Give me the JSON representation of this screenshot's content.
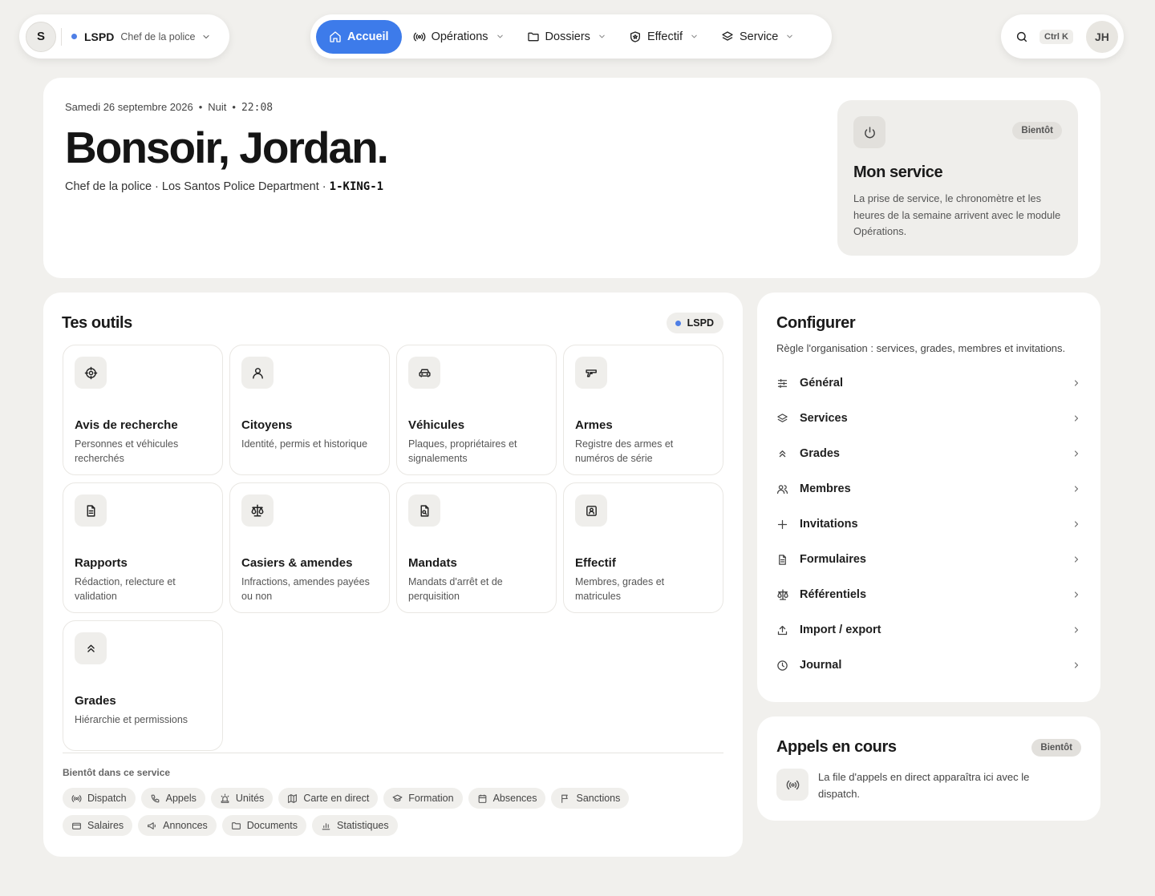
{
  "org": {
    "avatar": "S",
    "name": "LSPD",
    "role": "Chef de la police",
    "accent": "#4f7fe6"
  },
  "nav": {
    "items": [
      {
        "label": "Accueil",
        "icon": "home-icon",
        "active": true
      },
      {
        "label": "Opérations",
        "icon": "broadcast-icon"
      },
      {
        "label": "Dossiers",
        "icon": "folder-icon"
      },
      {
        "label": "Effectif",
        "icon": "shield-badge-icon"
      },
      {
        "label": "Service",
        "icon": "layers-icon"
      }
    ],
    "active_color": "#3d7bea"
  },
  "toolbar": {
    "shortcut": "Ctrl K",
    "user_initials": "JH"
  },
  "hero": {
    "date": "Samedi 26 septembre 2026",
    "period": "Nuit",
    "time": "22:08",
    "greeting": "Bonsoir, Jordan.",
    "subtitle": "Chef de la police · Los Santos Police Department · ",
    "callsign": "1-KING-1"
  },
  "service": {
    "badge": "Bientôt",
    "title": "Mon service",
    "text": "La prise de service, le chronomètre et les heures de la semaine arrivent avec le module Opérations."
  },
  "outils": {
    "title": "Tes outils",
    "badge": "LSPD",
    "tiles": [
      {
        "title": "Avis de recherche",
        "desc": "Personnes et véhicules recherchés",
        "icon": "target-icon"
      },
      {
        "title": "Citoyens",
        "desc": "Identité, permis et historique",
        "icon": "person-icon"
      },
      {
        "title": "Véhicules",
        "desc": "Plaques, propriétaires et signalements",
        "icon": "car-icon"
      },
      {
        "title": "Armes",
        "desc": "Registre des armes et numéros de série",
        "icon": "gun-icon"
      },
      {
        "title": "Rapports",
        "desc": "Rédaction, relecture et validation",
        "icon": "document-icon"
      },
      {
        "title": "Casiers & amendes",
        "desc": "Infractions, amendes payées ou non",
        "icon": "scale-icon"
      },
      {
        "title": "Mandats",
        "desc": "Mandats d'arrêt et de perquisition",
        "icon": "warrant-icon"
      },
      {
        "title": "Effectif",
        "desc": "Membres, grades et matricules",
        "icon": "id-card-icon"
      },
      {
        "title": "Grades",
        "desc": "Hiérarchie et permissions",
        "icon": "chevrons-up-icon"
      }
    ],
    "soon_label": "Bientôt dans ce service",
    "soon": [
      {
        "label": "Dispatch",
        "icon": "broadcast-icon"
      },
      {
        "label": "Appels",
        "icon": "phone-icon"
      },
      {
        "label": "Unités",
        "icon": "siren-icon"
      },
      {
        "label": "Carte en direct",
        "icon": "map-icon"
      },
      {
        "label": "Formation",
        "icon": "graduation-icon"
      },
      {
        "label": "Absences",
        "icon": "calendar-icon"
      },
      {
        "label": "Sanctions",
        "icon": "flag-icon"
      },
      {
        "label": "Salaires",
        "icon": "wallet-icon"
      },
      {
        "label": "Annonces",
        "icon": "megaphone-icon"
      },
      {
        "label": "Documents",
        "icon": "folder-icon"
      },
      {
        "label": "Statistiques",
        "icon": "bar-chart-icon"
      }
    ]
  },
  "config": {
    "title": "Configurer",
    "subtitle": "Règle l'organisation : services, grades, membres et invitations.",
    "items": [
      {
        "label": "Général",
        "icon": "sliders-icon"
      },
      {
        "label": "Services",
        "icon": "layers-icon"
      },
      {
        "label": "Grades",
        "icon": "chevrons-up-icon"
      },
      {
        "label": "Membres",
        "icon": "users-icon"
      },
      {
        "label": "Invitations",
        "icon": "plus-icon"
      },
      {
        "label": "Formulaires",
        "icon": "document-icon"
      },
      {
        "label": "Référentiels",
        "icon": "scale-icon"
      },
      {
        "label": "Import / export",
        "icon": "upload-icon"
      },
      {
        "label": "Journal",
        "icon": "clock-icon"
      }
    ]
  },
  "appels": {
    "title": "Appels en cours",
    "badge": "Bientôt",
    "text": "La file d'appels en direct apparaîtra ici avec le dispatch."
  }
}
